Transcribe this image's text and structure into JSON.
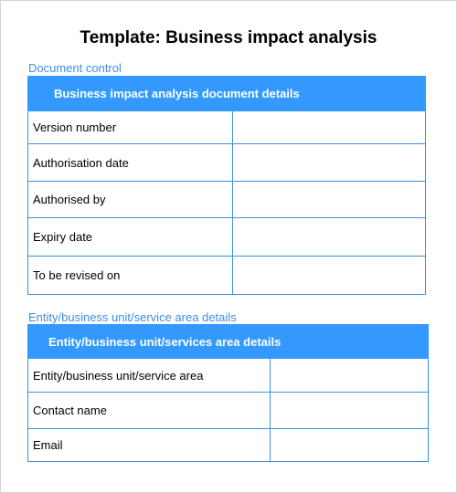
{
  "title": "Template: Business impact analysis",
  "sections": [
    {
      "label": "Document control",
      "table_header": "Business impact analysis document details",
      "rows": [
        {
          "label": "Version number",
          "value": ""
        },
        {
          "label": "Authorisation date",
          "value": ""
        },
        {
          "label": "Authorised by",
          "value": ""
        },
        {
          "label": "Expiry date",
          "value": ""
        },
        {
          "label": "To be revised on",
          "value": ""
        }
      ]
    },
    {
      "label": "Entity/business unit/service area details",
      "table_header": "Entity/business unit/services  area details",
      "rows": [
        {
          "label": "Entity/business unit/service area",
          "value": ""
        },
        {
          "label": "Contact name",
          "value": ""
        },
        {
          "label": "Email",
          "value": ""
        }
      ]
    }
  ],
  "colors": {
    "accent": "#3399ff",
    "label_text": "#3a8fe8"
  }
}
